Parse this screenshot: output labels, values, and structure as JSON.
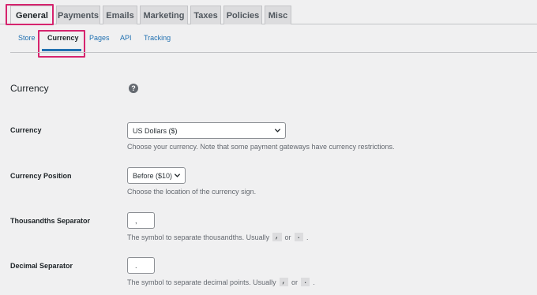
{
  "tabs": [
    "General",
    "Payments",
    "Emails",
    "Marketing",
    "Taxes",
    "Policies",
    "Misc"
  ],
  "active_tab": "General",
  "subnav": [
    "Store",
    "Currency",
    "Pages",
    "API",
    "Tracking"
  ],
  "active_subnav": "Currency",
  "section": {
    "title": "Currency",
    "help_icon": "help-icon"
  },
  "fields": {
    "currency": {
      "label": "Currency",
      "value": "US Dollars ($)",
      "description": "Choose your currency. Note that some payment gateways have currency restrictions."
    },
    "position": {
      "label": "Currency Position",
      "value": "Before ($10)",
      "description": "Choose the location of the currency sign."
    },
    "thousands": {
      "label": "Thousandths Separator",
      "value": ",",
      "description_prefix": "The symbol to separate thousandths. Usually",
      "code1": ",",
      "or": "or",
      "code2": ".",
      "suffix": "."
    },
    "decimal": {
      "label": "Decimal Separator",
      "value": ".",
      "description_prefix": "The symbol to separate decimal points. Usually",
      "code1": ",",
      "or": "or",
      "code2": ".",
      "suffix": "."
    }
  },
  "colors": {
    "highlight": "#d6246e",
    "link": "#2271b1"
  }
}
